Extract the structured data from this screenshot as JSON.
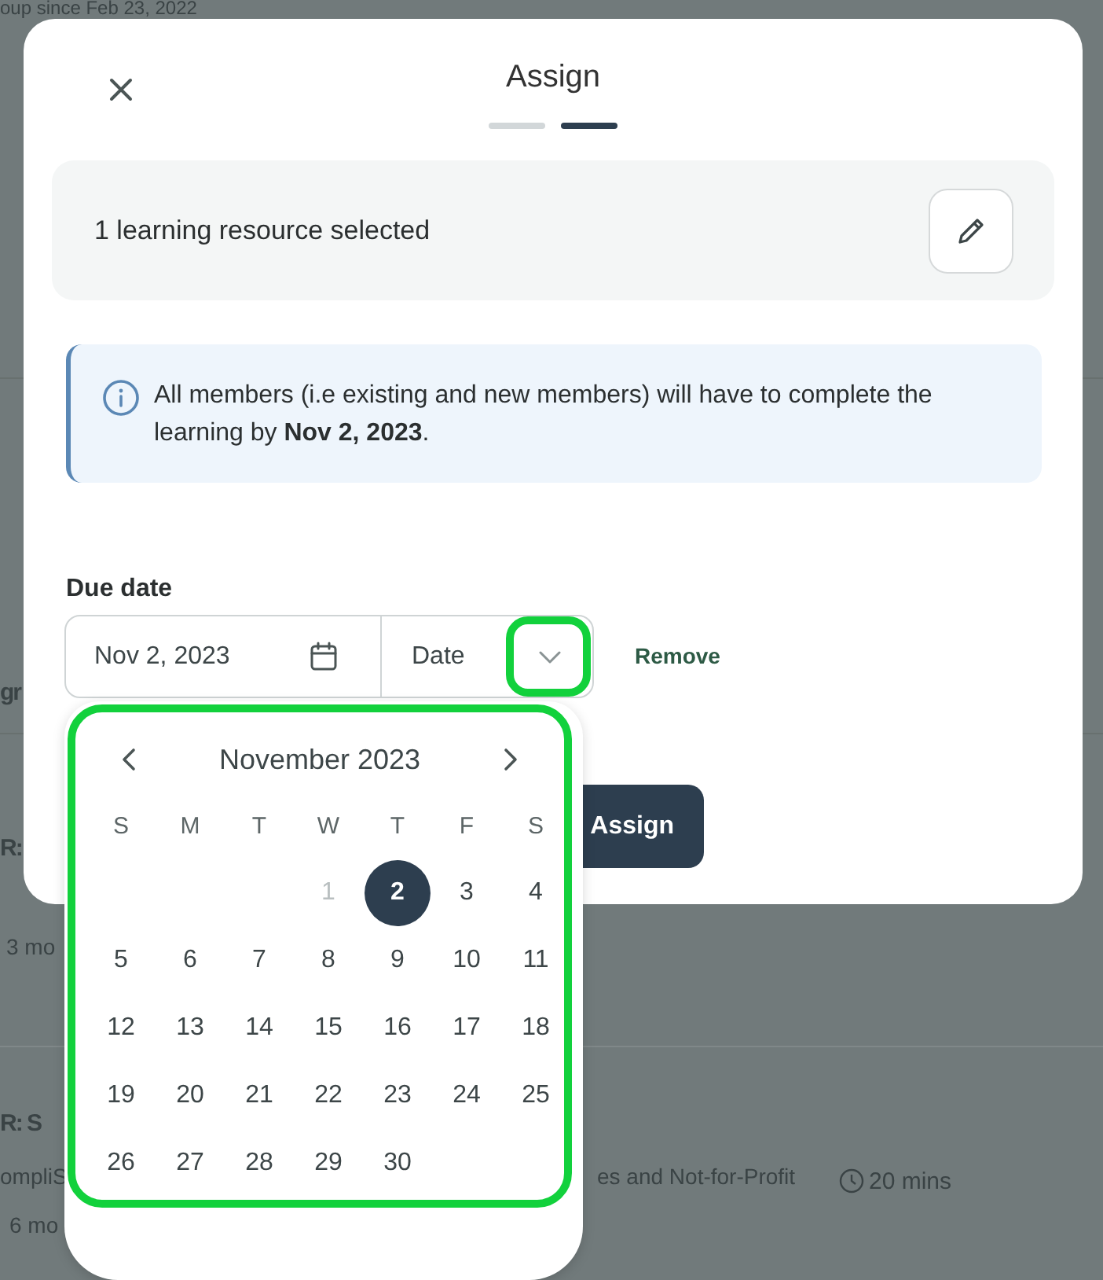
{
  "background_page": [
    {
      "kind": "text",
      "text": "oup since Feb 23, 2022"
    },
    {
      "kind": "title",
      "text": "gr"
    },
    {
      "kind": "title",
      "text": "R:"
    },
    {
      "kind": "text",
      "text": "3 mo"
    },
    {
      "kind": "title",
      "text": "R: S"
    },
    {
      "kind": "text",
      "text": "ompliS"
    },
    {
      "kind": "text",
      "text": "es and Not-for-Profit"
    },
    {
      "kind": "duration",
      "text": "20 mins"
    },
    {
      "kind": "text",
      "text": "6 mo"
    }
  ],
  "dialog": {
    "title": "Assign",
    "steps": [
      {
        "selected": false
      },
      {
        "selected": true
      }
    ],
    "selection_summary": "1 learning resource selected",
    "info": "All members (i.e existing and new members) will have to complete the learning by **Nov 2, 2023**.",
    "due_date": {
      "label": "Due date",
      "value": "Nov 2, 2023",
      "type": "Date",
      "type_highlighted": true,
      "remove": "Remove"
    },
    "primary_button": "Assign"
  },
  "calendar": {
    "month": "November 2023",
    "highlighted": true,
    "weekdays": [
      "S",
      "M",
      "T",
      "W",
      "T",
      "F",
      "S"
    ],
    "weeks": [
      [
        {
          "day": "1",
          "selected": false,
          "disabled": true
        },
        {
          "day": "2",
          "selected": true,
          "disabled": false
        },
        {
          "day": "3",
          "selected": false,
          "disabled": false
        },
        {
          "day": "4",
          "selected": false,
          "disabled": false
        }
      ],
      [
        {
          "day": "5",
          "selected": false,
          "disabled": false
        },
        {
          "day": "6",
          "selected": false,
          "disabled": false
        },
        {
          "day": "7",
          "selected": false,
          "disabled": false
        },
        {
          "day": "8",
          "selected": false,
          "disabled": false
        },
        {
          "day": "9",
          "selected": false,
          "disabled": false
        },
        {
          "day": "10",
          "selected": false,
          "disabled": false
        },
        {
          "day": "11",
          "selected": false,
          "disabled": false
        }
      ],
      [
        {
          "day": "12",
          "selected": false,
          "disabled": false
        },
        {
          "day": "13",
          "selected": false,
          "disabled": false
        },
        {
          "day": "14",
          "selected": false,
          "disabled": false
        },
        {
          "day": "15",
          "selected": false,
          "disabled": false
        },
        {
          "day": "16",
          "selected": false,
          "disabled": false
        },
        {
          "day": "17",
          "selected": false,
          "disabled": false
        },
        {
          "day": "18",
          "selected": false,
          "disabled": false
        }
      ],
      [
        {
          "day": "19",
          "selected": false,
          "disabled": false
        },
        {
          "day": "20",
          "selected": false,
          "disabled": false
        },
        {
          "day": "21",
          "selected": false,
          "disabled": false
        },
        {
          "day": "22",
          "selected": false,
          "disabled": false
        },
        {
          "day": "23",
          "selected": false,
          "disabled": false
        },
        {
          "day": "24",
          "selected": false,
          "disabled": false
        },
        {
          "day": "25",
          "selected": false,
          "disabled": false
        }
      ],
      [
        {
          "day": "26",
          "selected": false,
          "disabled": false
        },
        {
          "day": "27",
          "selected": false,
          "disabled": false
        },
        {
          "day": "28",
          "selected": false,
          "disabled": false
        },
        {
          "day": "29",
          "selected": false,
          "disabled": false
        },
        {
          "day": "30",
          "selected": false,
          "disabled": false
        }
      ]
    ]
  }
}
